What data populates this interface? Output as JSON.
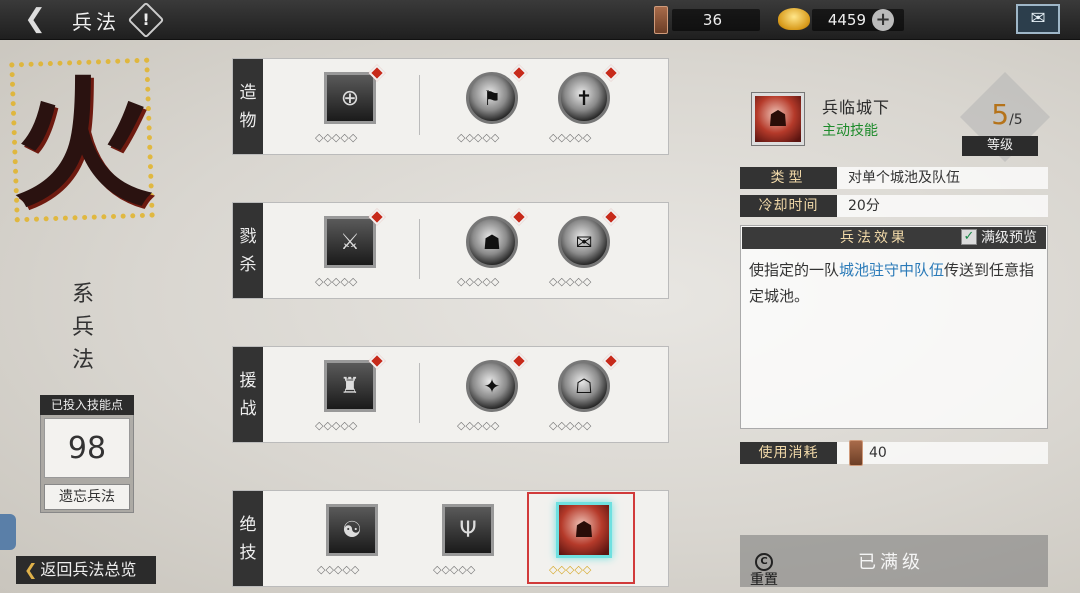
{
  "topbar": {
    "title": "兵法",
    "back_icon": "back-arrow-icon",
    "info_icon": "info-icon",
    "info_mark": "!",
    "token_count": "36",
    "gold_count": "4459",
    "add_symbol": "+",
    "mail_icon": "mail-icon"
  },
  "left": {
    "school_char": "火",
    "school_name": "系兵法",
    "points_label": "已投入技能点",
    "points_value": "98",
    "forget_label": "遗忘兵法",
    "return_label": "返回兵法总览"
  },
  "rows": [
    {
      "label": "造物",
      "skills": [
        {
          "icon": "crossroad-emblem-icon",
          "shape": "square",
          "red_dot": true,
          "glyph": "⊕"
        },
        {
          "icon": "flag-bearer-icon",
          "shape": "round",
          "red_dot": true,
          "glyph": "⚑"
        },
        {
          "icon": "signpost-icon",
          "shape": "round",
          "red_dot": true,
          "glyph": "✝"
        }
      ]
    },
    {
      "label": "戮杀",
      "skills": [
        {
          "icon": "spear-warrior-icon",
          "shape": "square",
          "red_dot": true,
          "glyph": "⚔"
        },
        {
          "icon": "charging-soldier-icon",
          "shape": "round",
          "red_dot": true,
          "glyph": "☗"
        },
        {
          "icon": "command-token-icon",
          "shape": "round",
          "red_dot": true,
          "glyph": "✉"
        }
      ]
    },
    {
      "label": "援战",
      "skills": [
        {
          "icon": "city-gate-icon",
          "shape": "square",
          "red_dot": true,
          "glyph": "♜"
        },
        {
          "icon": "slash-strike-icon",
          "shape": "round",
          "red_dot": true,
          "glyph": "✦"
        },
        {
          "icon": "helmet-general-icon",
          "shape": "round",
          "red_dot": true,
          "glyph": "☖"
        }
      ]
    },
    {
      "label": "绝技",
      "skills": [
        {
          "icon": "sitting-monk-icon",
          "shape": "square",
          "red_dot": false,
          "glyph": "☯"
        },
        {
          "icon": "trident-icon",
          "shape": "square",
          "red_dot": false,
          "glyph": "Ψ"
        },
        {
          "icon": "troops-at-gates-icon",
          "shape": "selected",
          "red_dot": false,
          "glyph": "☗"
        }
      ]
    }
  ],
  "detail": {
    "name": "兵临城下",
    "type": "主动技能",
    "level_current": "5",
    "level_max": "/5",
    "level_label": "等级",
    "props": [
      {
        "key": "类型",
        "value": "对单个城池及队伍"
      },
      {
        "key": "冷却时间",
        "value": "20分"
      }
    ],
    "effect_title": "兵法效果",
    "preview_label": "满级预览",
    "preview_checked": true,
    "effect_pre": "使指定的一队",
    "effect_highlight": "城池驻守中队伍",
    "effect_post": "传送到任意指定城池。",
    "cost_key": "使用消耗",
    "cost_value": "40",
    "reset_label": "重置",
    "max_label": "已满级"
  },
  "colors": {
    "accent_gold": "#d5a92a",
    "highlight_blue": "#2a7ab8",
    "active_green": "#1c8a2a",
    "red_dot": "#c72a1a",
    "selected_border": "#6fe0e0"
  }
}
